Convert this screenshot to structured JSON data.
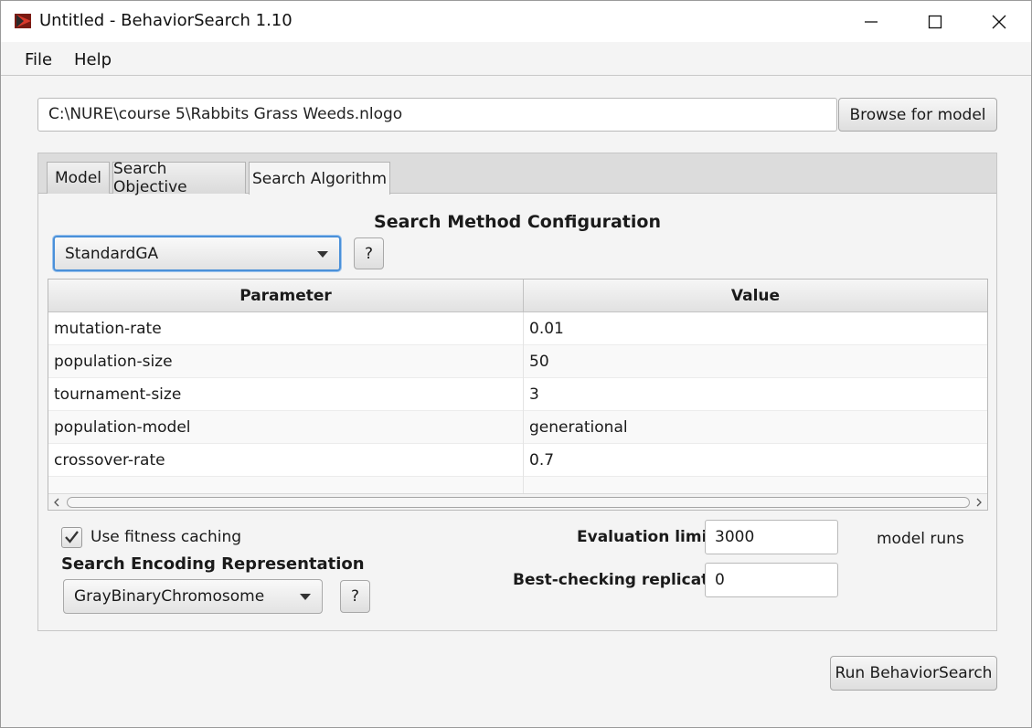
{
  "window": {
    "title": "Untitled - BehaviorSearch 1.10",
    "icon": "behaviorsearch-app-icon"
  },
  "menubar": {
    "items": [
      "File",
      "Help"
    ]
  },
  "model_path": {
    "value": "C:\\NURE\\course 5\\Rabbits Grass Weeds.nlogo",
    "browse_label": "Browse for model"
  },
  "tabs": [
    {
      "label": "Model",
      "active": false
    },
    {
      "label": "Search Objective",
      "active": false
    },
    {
      "label": "Search Algorithm",
      "active": true
    }
  ],
  "search_method": {
    "heading": "Search Method Configuration",
    "selected": "StandardGA",
    "help_label": "?"
  },
  "parameters_table": {
    "columns": [
      "Parameter",
      "Value"
    ],
    "rows": [
      {
        "parameter": "mutation-rate",
        "value": "0.01"
      },
      {
        "parameter": "population-size",
        "value": "50"
      },
      {
        "parameter": "tournament-size",
        "value": "3"
      },
      {
        "parameter": "population-model",
        "value": "generational"
      },
      {
        "parameter": "crossover-rate",
        "value": "0.7"
      }
    ]
  },
  "fitness_caching": {
    "label": "Use fitness caching",
    "checked": true
  },
  "encoding": {
    "heading": "Search Encoding Representation",
    "selected": "GrayBinaryChromosome",
    "help_label": "?"
  },
  "evaluation_limit": {
    "label": "Evaluation limit:",
    "value": "3000",
    "unit": "model runs"
  },
  "best_checking": {
    "label": "Best-checking replicates:",
    "value": "0"
  },
  "run_button": {
    "label": "Run BehaviorSearch"
  },
  "colors": {
    "focus_ring": "#4a90d9",
    "background": "#f4f4f4"
  }
}
